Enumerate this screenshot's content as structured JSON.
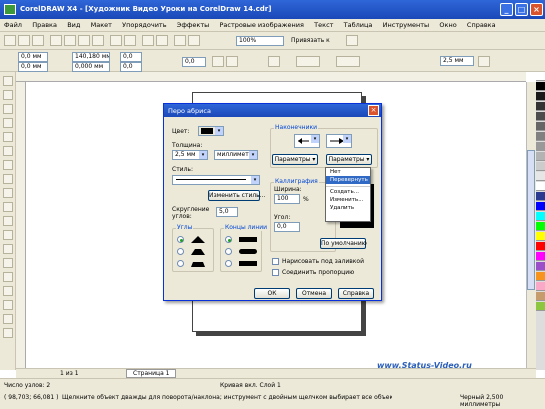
{
  "window": {
    "title": "CorelDRAW X4 - [Художник Видео Уроки на CorelDraw 14.cdr]",
    "min": "_",
    "max": "□",
    "close": "×"
  },
  "menu": [
    "Файл",
    "Правка",
    "Вид",
    "Макет",
    "Упорядочить",
    "Эффекты",
    "Растровые изображения",
    "Текст",
    "Таблица",
    "Инструменты",
    "Окно",
    "Справка"
  ],
  "toolbar": {
    "zoom": "100%",
    "snap": "Привязать к",
    "width_val": "0,0 мм",
    "height_val": "0,0 мм",
    "x_val": "140,180 мм",
    "y_val": "0,000 мм",
    "angle1": "0,0",
    "angle2": "0,0",
    "outline_size": "2,5 мм"
  },
  "dialog": {
    "title": "Перо абриса",
    "color_label": "Цвет:",
    "width_label": "Толщина:",
    "width_value": "2,5 мм",
    "units_value": "миллиметры",
    "style_label": "Стиль:",
    "edit_style_btn": "Изменить стиль...",
    "miter_label": "Скругление углов:",
    "miter_value": "5,0",
    "corners_title": "Углы",
    "caps_title": "Концы линии",
    "arrows_title": "Наконечники",
    "arrows_btn1": "Параметры",
    "arrows_btn2": "Параметры",
    "calligraphy_title": "Каллиграфия",
    "stretch_label": "Ширина:",
    "stretch_value": "100",
    "percent": "%",
    "angle_label": "Угол:",
    "angle_value": "0,0",
    "default_btn": "По умолчанию",
    "behind_fill": "Нарисовать под заливкой",
    "scale_with": "Соединить пропорцию",
    "ok": "ОК",
    "cancel": "Отмена",
    "help": "Справка"
  },
  "context_menu": [
    "Нет",
    "Перевернуть",
    "Создать...",
    "Изменить...",
    "Удалить"
  ],
  "page_tab": "Страница 1",
  "page_nav": "1 из 1",
  "watermark": "www.Status-Video.ru",
  "status": {
    "line1_left": "Число узлов: 2",
    "line1_mid": "Кривая вкл. Слой 1",
    "line2_left": "( 98,703; 66,081 )",
    "line2_mid": "Щелкните объект дважды для поворота/наклона; инструмент с двойным щелчком выбирает все объекты; SHIFT+щелчок - выборка...",
    "line2_right": "Черный 2,500 миллиметры"
  },
  "colors": {
    "accent": "#1a48b8",
    "close": "#d9532c",
    "watermark": "#2b5fb8"
  }
}
